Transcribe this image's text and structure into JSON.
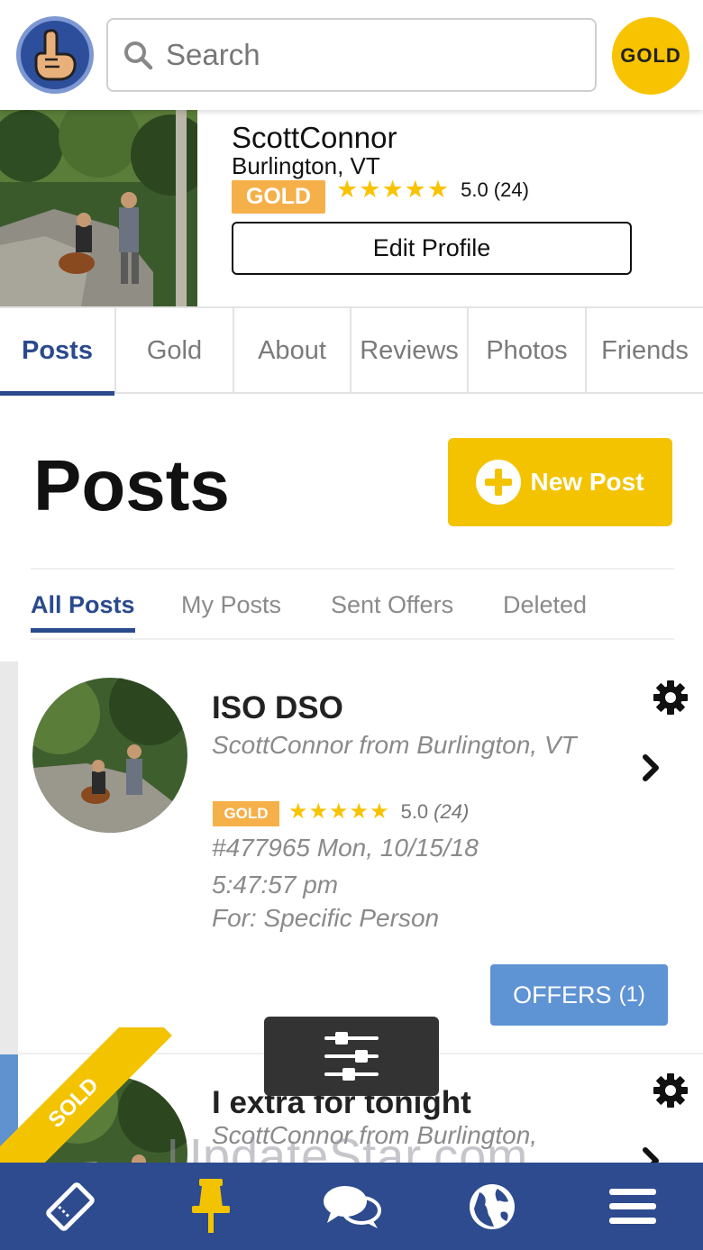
{
  "header": {
    "search_placeholder": "Search",
    "gold_badge": "GOLD"
  },
  "profile": {
    "name": "ScottConnor",
    "location": "Burlington, VT",
    "tier": "GOLD",
    "rating": "5.0 (24)",
    "stars": 5,
    "edit_label": "Edit Profile"
  },
  "tabs": [
    {
      "label": "Posts",
      "active": true
    },
    {
      "label": "Gold",
      "active": false
    },
    {
      "label": "About",
      "active": false
    },
    {
      "label": "Reviews",
      "active": false
    },
    {
      "label": "Photos",
      "active": false
    },
    {
      "label": "Friends",
      "active": false
    }
  ],
  "posts_section": {
    "title": "Posts",
    "new_post_label": "New Post",
    "subtabs": [
      {
        "label": "All Posts",
        "active": true
      },
      {
        "label": "My Posts",
        "active": false
      },
      {
        "label": "Sent Offers",
        "active": false
      },
      {
        "label": "Deleted",
        "active": false
      }
    ]
  },
  "posts": [
    {
      "title": "ISO DSO",
      "from": "ScottConnor from Burlington, VT",
      "tier": "GOLD",
      "rating": "5.0",
      "rating_count": "(24)",
      "meta": "#477965 Mon, 10/15/18 5:47:57 pm",
      "for": "For: Specific Person",
      "offers_label": "OFFERS",
      "offers_count": "(1)"
    },
    {
      "title": "I extra for tonight",
      "from": "ScottConnor from Burlington,",
      "ribbon": "SOLD"
    }
  ],
  "watermark": "UpdateStar.com",
  "bottom_nav": [
    "ticket-icon",
    "pin-icon",
    "chat-icon",
    "globe-icon",
    "menu-icon"
  ],
  "colors": {
    "brand_blue": "#2d4b8e",
    "gold": "#f3c300",
    "gold_tag": "#f5b04a",
    "offers_blue": "#5e93d4"
  }
}
